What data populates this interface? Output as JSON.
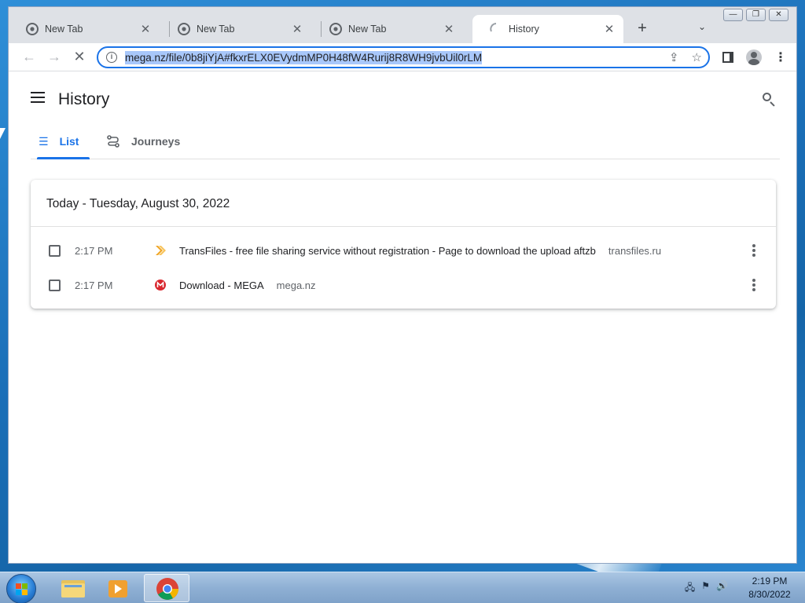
{
  "browser": {
    "tabs": [
      {
        "title": "New Tab",
        "icon": "chrome-icon",
        "active": false
      },
      {
        "title": "New Tab",
        "icon": "chrome-icon",
        "active": false
      },
      {
        "title": "New Tab",
        "icon": "chrome-icon",
        "active": false
      },
      {
        "title": "History",
        "icon": "loading-spinner-icon",
        "active": true
      }
    ],
    "new_tab_label": "+",
    "address_bar": {
      "url": "mega.nz/file/0b8jiYjA#fkxrELX0EVydmMP0H48fW4Rurij8R8WH9jvbUil0rLM"
    }
  },
  "history_page": {
    "title": "History",
    "tabs": [
      {
        "label": "List",
        "icon": "list-icon",
        "selected": true
      },
      {
        "label": "Journeys",
        "icon": "journeys-icon",
        "selected": false
      }
    ],
    "day_header": "Today - Tuesday, August 30, 2022",
    "entries": [
      {
        "time": "2:17 PM",
        "title": "TransFiles - free file sharing service without registration - Page to download the upload aftzb",
        "domain": "transfiles.ru",
        "icon": "transfiles-icon"
      },
      {
        "time": "2:17 PM",
        "title": "Download - MEGA",
        "domain": "mega.nz",
        "icon": "mega-icon"
      }
    ]
  },
  "taskbar": {
    "clock_time": "2:19 PM",
    "clock_date": "8/30/2022"
  },
  "colors": {
    "accent": "#1a73e8",
    "mega_red": "#d9272e",
    "transfiles_orange": "#f0a626"
  }
}
